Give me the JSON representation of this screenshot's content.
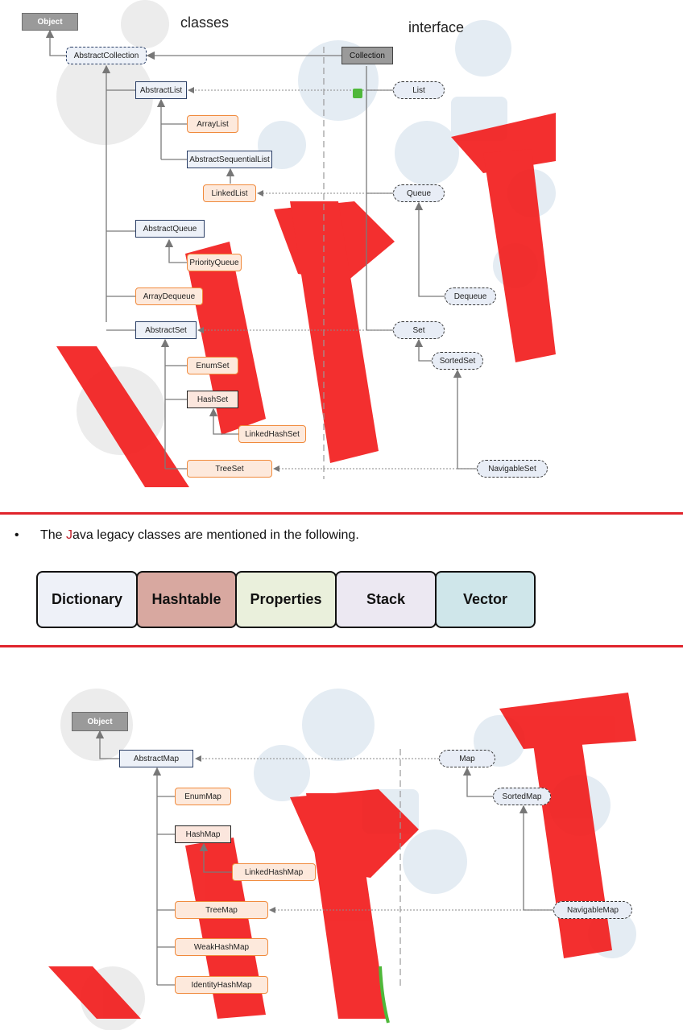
{
  "top_diagram": {
    "heading_classes": "classes",
    "heading_interface": "interface",
    "nodes": {
      "object": "Object",
      "abstract_collection": "AbstractCollection",
      "collection": "Collection",
      "abstract_list": "AbstractList",
      "list": "List",
      "array_list": "ArrayList",
      "abstract_sequential_list": "AbstractSequentialList",
      "linked_list": "LinkedList",
      "queue": "Queue",
      "abstract_queue": "AbstractQueue",
      "priority_queue": "PriorityQueue",
      "array_dequeue": "ArrayDequeue",
      "dequeue": "Dequeue",
      "abstract_set": "AbstractSet",
      "set": "Set",
      "sorted_set": "SortedSet",
      "enum_set": "EnumSet",
      "hash_set": "HashSet",
      "linked_hash_set": "LinkedHashSet",
      "tree_set": "TreeSet",
      "navigable_set": "NavigableSet"
    }
  },
  "legacy_section": {
    "bullet": "•",
    "text_before": "The ",
    "text_highlight": "J",
    "text_after": "ava legacy classes are mentioned in the following.",
    "boxes": [
      {
        "label": "Dictionary",
        "color": "#eef1f8"
      },
      {
        "label": "Hashtable",
        "color": "#d8a8a0"
      },
      {
        "label": "Properties",
        "color": "#eaf0dc"
      },
      {
        "label": "Stack",
        "color": "#ece8f2"
      },
      {
        "label": "Vector",
        "color": "#cfe6ea"
      }
    ]
  },
  "map_diagram": {
    "nodes": {
      "object": "Object",
      "abstract_map": "AbstractMap",
      "map": "Map",
      "sorted_map": "SortedMap",
      "enum_map": "EnumMap",
      "hash_map": "HashMap",
      "linked_hash_map": "LinkedHashMap",
      "tree_map": "TreeMap",
      "navigable_map": "NavigableMap",
      "weak_hash_map": "WeakHashMap",
      "identity_hash_map": "IdentityHashMap"
    }
  },
  "colors": {
    "separator_red": "#e0242c",
    "watermark_red": "#f01c1c",
    "green_marker": "#4fb83a",
    "concrete_border": "#f08a3c"
  }
}
